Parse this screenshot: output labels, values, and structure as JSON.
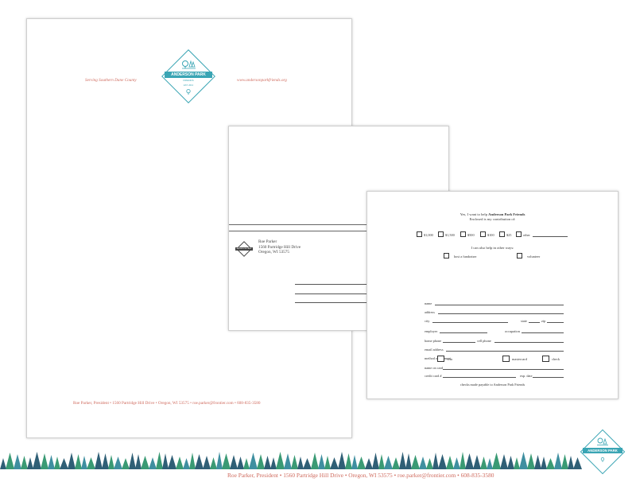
{
  "letterhead": {
    "left_text": "Serving Southern Dane County",
    "right_text": "www.andersonparkfriends.org",
    "logo": {
      "name_line1": "ANDERSON PARK",
      "name_line2": "FRIENDS",
      "est": "EST. 2013"
    },
    "footer": "Roe Parker, President  •  1560 Partridge Hill Drive  •  Oregon, WI 53575  •  roe.parker@frontier.com  •  608-835-3580"
  },
  "envelope": {
    "return_address": [
      "Roe Parker",
      "1560 Partridge Hill Drive",
      "Oregon, WI 53575"
    ],
    "mini_logo": "ANDERSON PARK"
  },
  "reply_card": {
    "line1_prefix": "Yes, I want to help ",
    "line1_org": "Anderson Park Friends",
    "line2": "Enclosed is my contribution of:",
    "amounts": [
      "$1,000",
      "$1,500",
      "$500",
      "$100",
      "$25",
      "other"
    ],
    "help_text": "I can also help in other ways:",
    "help_options": [
      "host a fundraiser",
      "volunteer"
    ],
    "fields": {
      "name": "name",
      "address": "address",
      "city": "city",
      "state": "state",
      "zip": "zip",
      "employer": "employer",
      "occupation": "occupation",
      "home_phone": "home phone",
      "cell_phone": "cell phone",
      "email": "email address",
      "payment": "method of payment",
      "visa": "visa",
      "mastercard": "mastercard",
      "check": "check",
      "name_on_card": "name on card",
      "card_number": "credit card #",
      "exp": "exp. date"
    },
    "note": "checks made payable to Anderson Park Friends"
  },
  "footer_bar": {
    "logo_line1": "ANDERSON PARK",
    "contact": "Roe Parker, President  •  1560 Partridge Hill Drive  •  Oregon, WI 53575  •  roe.parker@frontier.com  •  608-835-3580"
  },
  "colors": {
    "teal": "#3aa5b4",
    "coral": "#cf6a5d",
    "tree_dark": "#2f5f76",
    "tree_green": "#3a9a74",
    "tree_mid": "#3f8fa0"
  }
}
